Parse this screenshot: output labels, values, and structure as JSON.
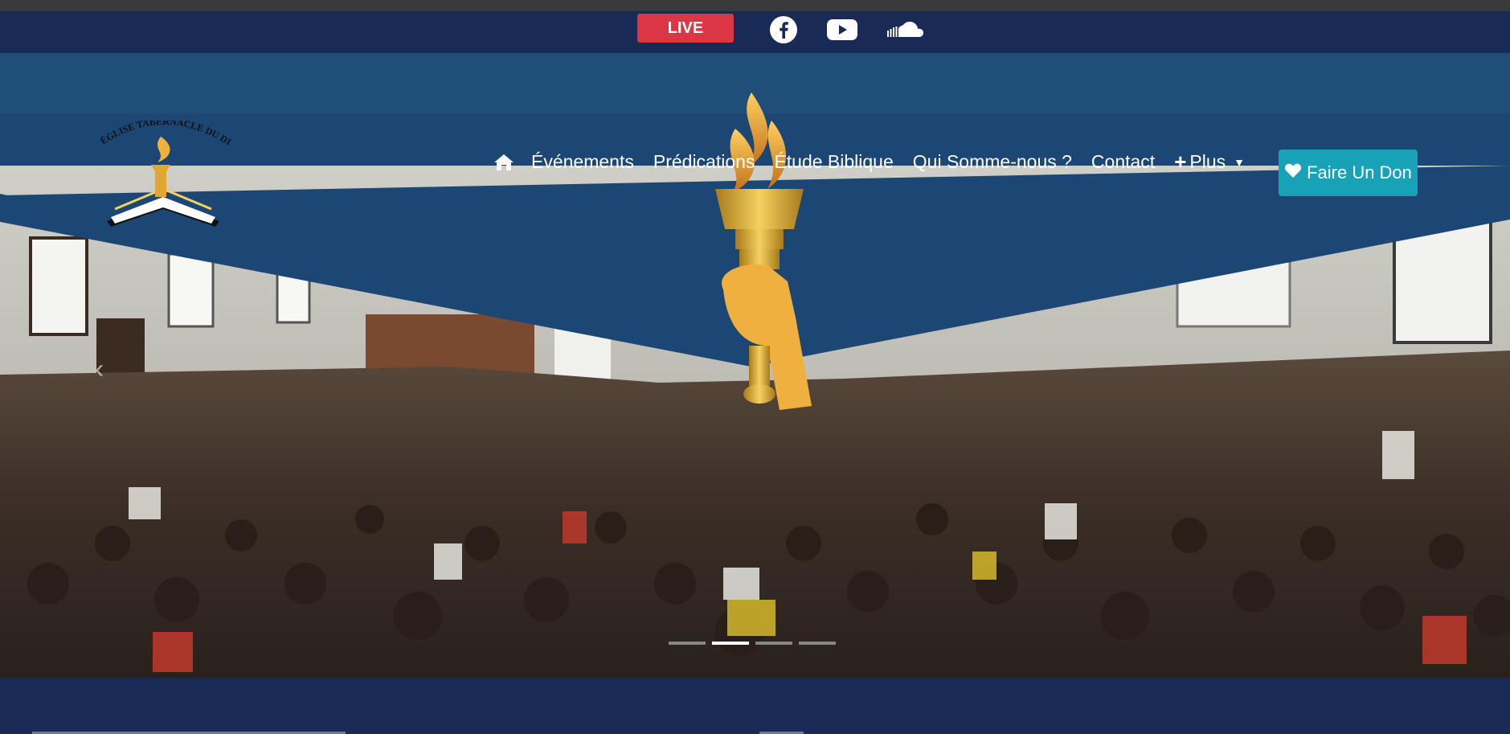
{
  "topbar": {
    "live_label": "LIVE",
    "social": [
      {
        "icon": "facebook-icon"
      },
      {
        "icon": "youtube-icon"
      },
      {
        "icon": "soundcloud-icon"
      }
    ]
  },
  "nav": {
    "home_icon": "home-icon",
    "items": [
      {
        "label": "Événements"
      },
      {
        "label": "Prédications"
      },
      {
        "label": "Étude Biblique"
      },
      {
        "label": "Qui Somme-nous ?"
      },
      {
        "label": "Contact"
      }
    ],
    "more_label": "Plus",
    "donate_label": "Faire Un Don"
  },
  "logo": {
    "text": "ÉGLISE TABERNACLE DU DIEU DE LA GRÂCE"
  },
  "carousel": {
    "slide_count": 4,
    "active_index": 1
  },
  "colors": {
    "topbar": "#1a2a57",
    "hero_band": "#1c4674",
    "live": "#dc3545",
    "donate": "#17a2b8"
  }
}
